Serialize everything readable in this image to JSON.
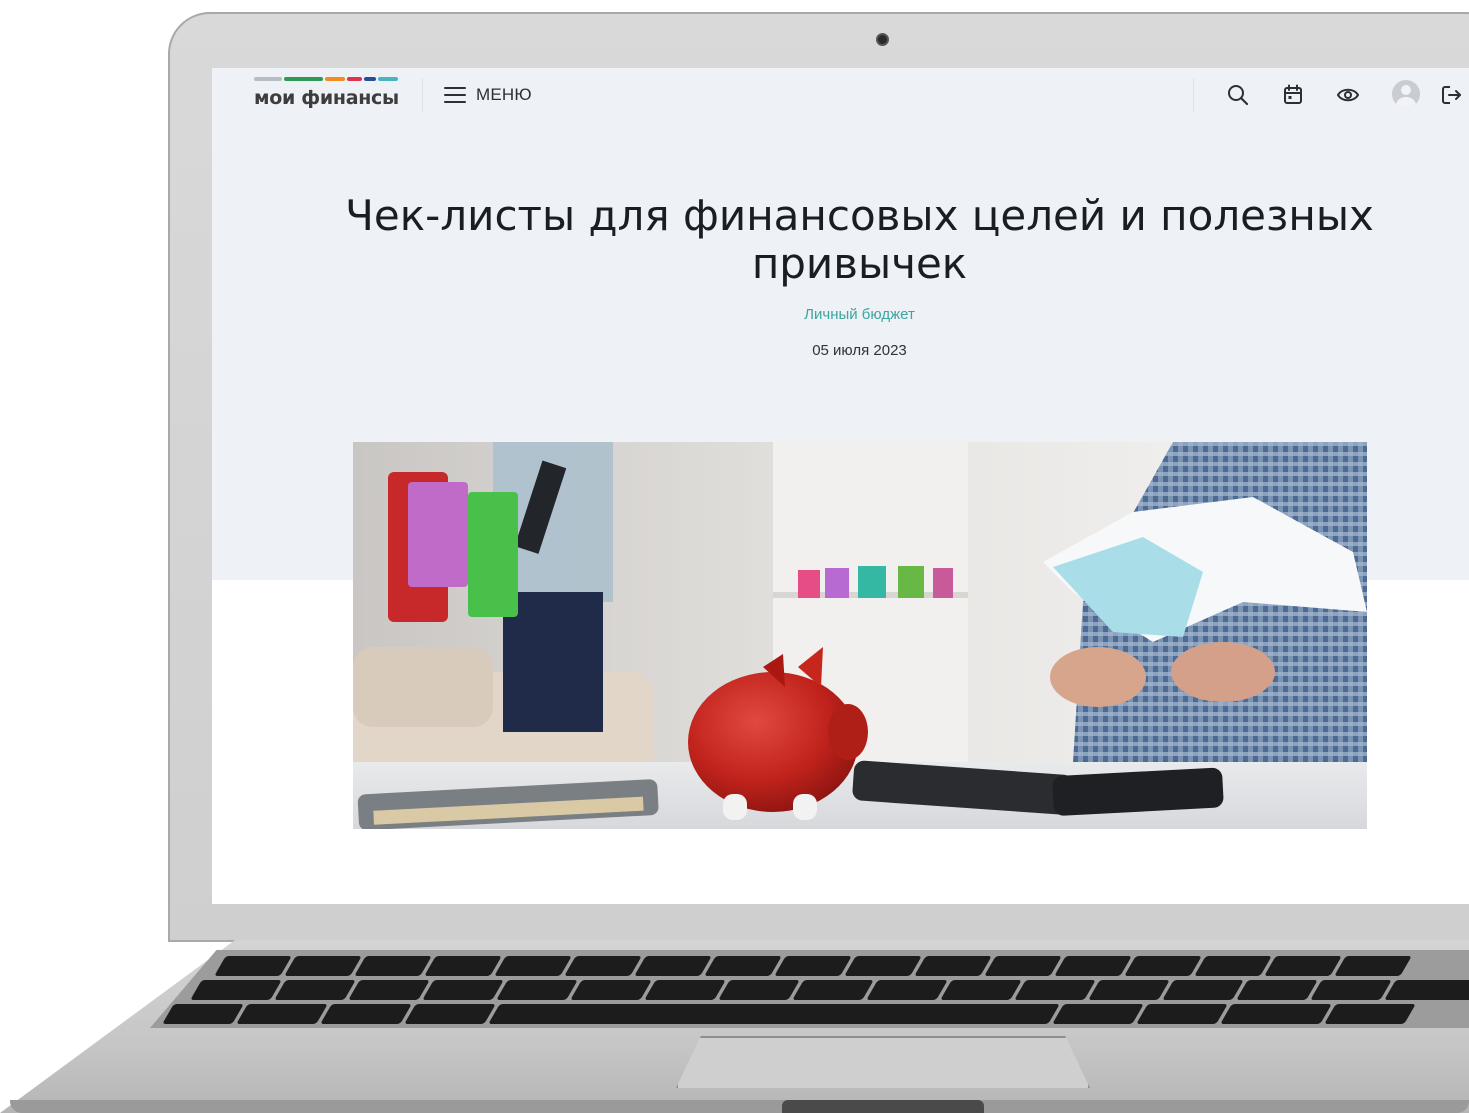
{
  "header": {
    "logo_text": "мои финансы",
    "logo_colors": [
      "#b8bcc3",
      "#2f9a55",
      "#f28b22",
      "#e0334f",
      "#2b4c9b",
      "#49b3c2"
    ],
    "menu_label": "МЕНЮ",
    "icons": [
      "search-icon",
      "calendar-icon",
      "eye-icon",
      "user-avatar",
      "logout-icon"
    ]
  },
  "article": {
    "title": "Чек-листы для финансовых целей и полезных привычек",
    "category": "Личный бюджет",
    "date": "05 июля 2023",
    "image_alt": "piggy-bank-and-receipts"
  },
  "colors": {
    "hero_background": "#eef1f6",
    "category_accent": "#3aa6a0",
    "text_primary": "#1a1d24"
  }
}
